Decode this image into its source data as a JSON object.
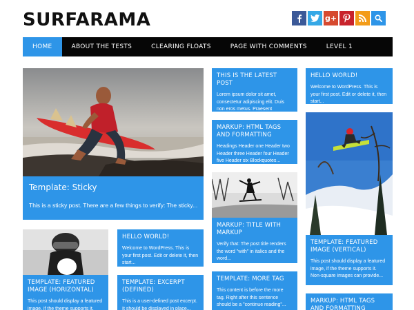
{
  "site": {
    "title": "SURFARAMA"
  },
  "social": [
    {
      "name": "facebook",
      "glyph": "f",
      "color": "#3b5998"
    },
    {
      "name": "twitter",
      "glyph": "t",
      "color": "#35a8e6"
    },
    {
      "name": "google-plus",
      "glyph": "g+",
      "color": "#d6492f"
    },
    {
      "name": "pinterest",
      "glyph": "P",
      "color": "#c8232c"
    },
    {
      "name": "rss",
      "glyph": "rss",
      "color": "#f39c19"
    },
    {
      "name": "search",
      "glyph": "search",
      "color": "#2e95e8"
    }
  ],
  "nav": {
    "items": [
      "HOME",
      "ABOUT THE TESTS",
      "CLEARING FLOATS",
      "PAGE WITH COMMENTS",
      "LEVEL 1"
    ],
    "active": 0
  },
  "posts": {
    "sticky": {
      "title": "Template: Sticky",
      "excerpt": "This is a sticky post. There are a few things to verify: The sticky..."
    },
    "latest": {
      "title": "THIS IS THE LATEST POST",
      "excerpt": "Lorem ipsum dolor sit amet, consectetur adipiscing elit. Duis non eros metus. Praesent convallis..."
    },
    "hello_right": {
      "title": "HELLO WORLD!",
      "excerpt": "Welcome to WordPress. This is your first post. Edit or delete it, then start..."
    },
    "html_tags": {
      "title": "MARKUP: HTML TAGS AND FORMATTING",
      "excerpt": "Headings Header one Header two Header three Header four Header five Header six Blockquotes..."
    },
    "title_markup": {
      "title": "MARKUP: TITLE WITH MARKUP",
      "excerpt": "Verify that: The post title renders the word \"with\" in italics and the word..."
    },
    "featured_vertical": {
      "title": "TEMPLATE: FEATURED IMAGE (VERTICAL)",
      "excerpt": "This post should display a featured image, if the theme supports it. Non-square images can provide..."
    },
    "featured_horizontal": {
      "title": "TEMPLATE: FEATURED IMAGE (HORIZONTAL)",
      "excerpt": "This post should display a featured image, if the theme supports it. Non-square images..."
    },
    "hello_mid": {
      "title": "HELLO WORLD!",
      "excerpt": "Welcome to WordPress. This is your first post. Edit or delete it, then start..."
    },
    "excerpt_defined": {
      "title": "TEMPLATE: EXCERPT (DEFINED)",
      "excerpt": "This is a user-defined post excerpt. It should be displayed in place..."
    },
    "more_tag": {
      "title": "TEMPLATE: MORE TAG",
      "excerpt": "This content is before the more tag. Right after this sentence should be a \"continue reading\"..."
    },
    "html_tags_bottom": {
      "title": "MARKUP: HTML TAGS AND FORMATTING"
    }
  }
}
